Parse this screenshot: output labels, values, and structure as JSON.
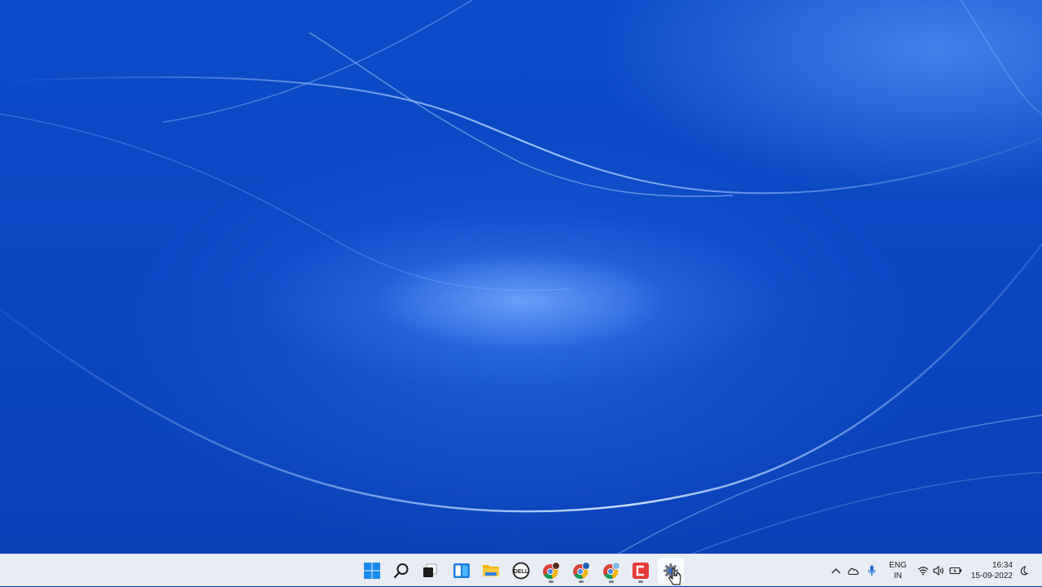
{
  "desktop": {
    "wallpaper": "windows-11-blue-bloom",
    "accent": "#0a47c4"
  },
  "taskbar": {
    "pinned": [
      {
        "name": "start-button",
        "icon": "windows-logo-icon"
      },
      {
        "name": "search-button",
        "icon": "search-icon"
      },
      {
        "name": "task-view-button",
        "icon": "task-view-icon"
      },
      {
        "name": "widgets-button",
        "icon": "widgets-icon"
      },
      {
        "name": "file-explorer-button",
        "icon": "folder-icon"
      },
      {
        "name": "dell-app-button",
        "icon": "dell-icon"
      },
      {
        "name": "chrome-profile-1-button",
        "icon": "chrome-icon",
        "running": true
      },
      {
        "name": "chrome-profile-2-button",
        "icon": "chrome-icon",
        "running": true
      },
      {
        "name": "chrome-profile-3-button",
        "icon": "chrome-icon",
        "running": true
      },
      {
        "name": "mcafee-button",
        "icon": "mcafee-icon",
        "running": true
      },
      {
        "name": "settings-button",
        "icon": "gear-icon",
        "active": true
      }
    ]
  },
  "tray": {
    "language_line1": "ENG",
    "language_line2": "IN",
    "time": "16:34",
    "date": "15-09-2022"
  }
}
